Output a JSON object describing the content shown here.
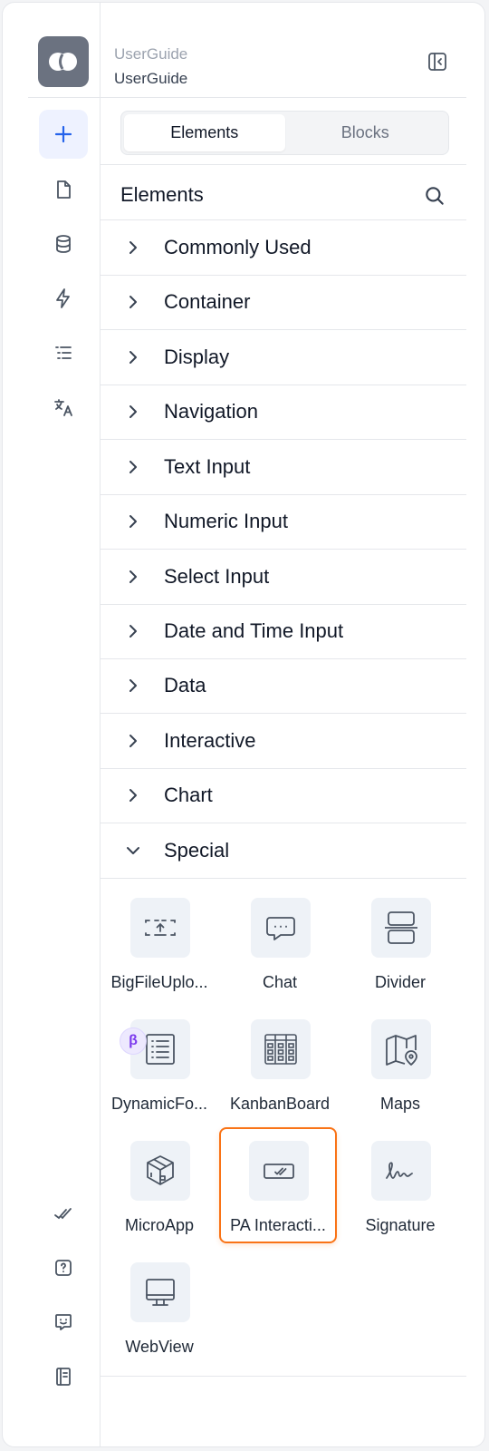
{
  "header": {
    "breadcrumb_top": "UserGuide",
    "breadcrumb_bottom": "UserGuide"
  },
  "tabs": [
    {
      "label": "Elements",
      "active": true
    },
    {
      "label": "Blocks",
      "active": false
    }
  ],
  "panel": {
    "title": "Elements"
  },
  "categories": [
    {
      "label": "Commonly Used",
      "expanded": false
    },
    {
      "label": "Container",
      "expanded": false
    },
    {
      "label": "Display",
      "expanded": false
    },
    {
      "label": "Navigation",
      "expanded": false
    },
    {
      "label": "Text Input",
      "expanded": false
    },
    {
      "label": "Numeric Input",
      "expanded": false
    },
    {
      "label": "Select Input",
      "expanded": false
    },
    {
      "label": "Date and Time Input",
      "expanded": false
    },
    {
      "label": "Data",
      "expanded": false
    },
    {
      "label": "Interactive",
      "expanded": false
    },
    {
      "label": "Chart",
      "expanded": false
    },
    {
      "label": "Special",
      "expanded": true
    }
  ],
  "special_items": [
    {
      "label": "BigFileUplo...",
      "icon": "upload-dashed-icon"
    },
    {
      "label": "Chat",
      "icon": "chat-bubble-icon"
    },
    {
      "label": "Divider",
      "icon": "divider-icon"
    },
    {
      "label": "DynamicFo...",
      "icon": "dynamic-form-icon",
      "badge": "β"
    },
    {
      "label": "KanbanBoard",
      "icon": "kanban-icon"
    },
    {
      "label": "Maps",
      "icon": "map-pin-icon"
    },
    {
      "label": "MicroApp",
      "icon": "box-icon"
    },
    {
      "label": "PA Interacti...",
      "icon": "pa-interaction-icon",
      "selected": true
    },
    {
      "label": "Signature",
      "icon": "signature-icon"
    },
    {
      "label": "WebView",
      "icon": "monitor-icon"
    }
  ],
  "colors": {
    "accent": "#2563eb",
    "selection": "#f97316",
    "beta": "#7c3aed"
  }
}
